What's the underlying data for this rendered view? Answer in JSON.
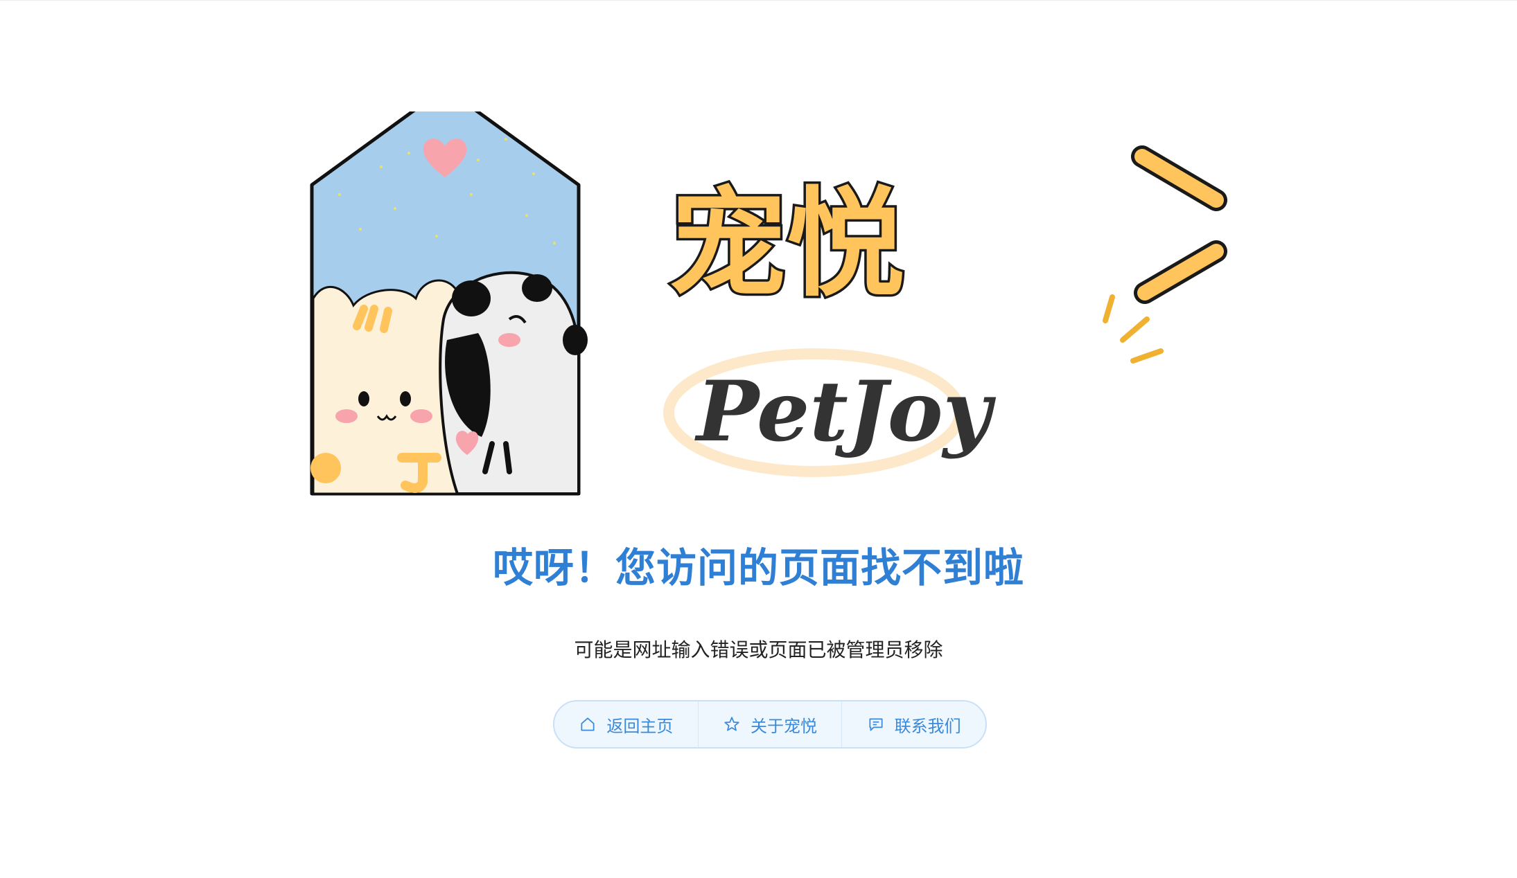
{
  "brand": {
    "name_cn": "宠悦",
    "name_en": "PetJoy",
    "logo_icon": "house-cat-dog-icon"
  },
  "heading": "哎呀！您访问的页面找不到啦",
  "subtext": "可能是网址输入错误或页面已被管理员移除",
  "actions": [
    {
      "label": "返回主页",
      "icon": "home-icon"
    },
    {
      "label": "关于宠悦",
      "icon": "star-icon"
    },
    {
      "label": "联系我们",
      "icon": "message-icon"
    }
  ],
  "colors": {
    "accent": "#2f7fd4",
    "button_text": "#3a8ad9",
    "button_bg": "#eef6fe",
    "brand_orange": "#ffc45c"
  }
}
